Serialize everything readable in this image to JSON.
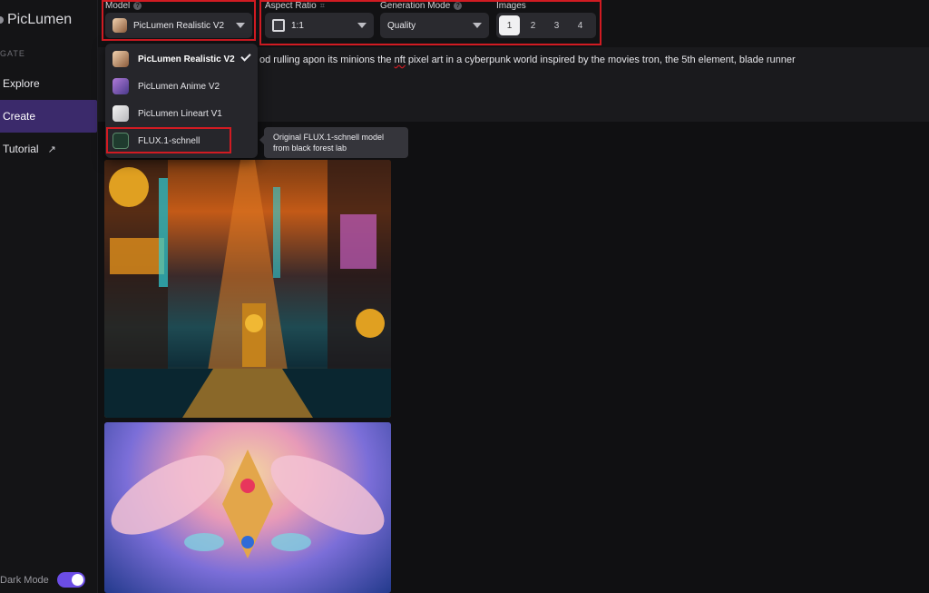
{
  "sidebar": {
    "brand": "PicLumen",
    "section_label": "GATE",
    "items": [
      {
        "label": "Explore",
        "active": false
      },
      {
        "label": "Create",
        "active": true
      },
      {
        "label": "Tutorial",
        "active": false,
        "external_icon": "↗"
      }
    ],
    "dark_mode_label": "Dark Mode",
    "dark_mode_on": true
  },
  "controls": {
    "model": {
      "label": "Model",
      "value": "PicLumen Realistic V2"
    },
    "aspect_ratio": {
      "label": "Aspect Ratio",
      "value": "1:1"
    },
    "generation_mode": {
      "label": "Generation Mode",
      "value": "Quality"
    },
    "images": {
      "label": "Images",
      "options": [
        "1",
        "2",
        "3",
        "4"
      ],
      "selected": "1"
    }
  },
  "prompt": {
    "text_before": "od rulling apon its minions the ",
    "misspelled": "nft",
    "text_after": " pixel art in a cyberpunk world inspired by the movies tron, the 5th element, blade runner"
  },
  "model_dropdown": {
    "items": [
      {
        "label": "PicLumen Realistic V2",
        "icon": "realistic-avatar-icon",
        "selected": true
      },
      {
        "label": "PicLumen Anime V2",
        "icon": "anime-avatar-icon",
        "selected": false
      },
      {
        "label": "PicLumen Lineart V1",
        "icon": "lineart-avatar-icon",
        "selected": false
      },
      {
        "label": "FLUX.1-schnell",
        "icon": "flux-logo-icon",
        "selected": false
      }
    ],
    "tooltip": {
      "line1": "Original FLUX.1-schnell model",
      "line2": "from black forest lab"
    }
  },
  "colors": {
    "accent": "#6b4de6",
    "active_nav": "#3b2a6b",
    "highlight_frame": "#d11b22"
  }
}
